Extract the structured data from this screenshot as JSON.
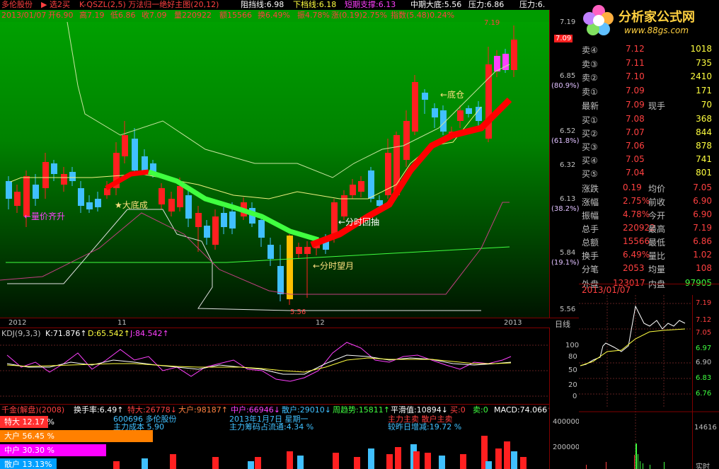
{
  "top": {
    "stock_name": "多伦股份",
    "arrow_select": "▶ 选2买",
    "indicator": "K-QSZL(2,5) 万法归一绝好主图(20,12)",
    "resistance": "阻挡线:6.98",
    "down_line": "下档线:6.18",
    "short_support": "短期支撑:6.13",
    "mid_bottom": "中期大底:5.56",
    "pressure1": "压力:6.86",
    "pressure2": "压力:6.",
    "line2": "2013/01/07",
    "open": "开6.90",
    "high": "高7.19",
    "low": "低6.86",
    "close": "收7.09",
    "volume": "量220922",
    "amount": "额15566",
    "turnover": "换6.49%",
    "amplitude": "振4.78%",
    "change": "涨(0.19)2.75%",
    "index": "指数(5.48)0.24%"
  },
  "chart_labels": {
    "volume_rise": "←量价齐升",
    "big_bottom": "★大底成",
    "minute_pull": "←分时回抽",
    "minute_moon": "←分时望月",
    "bottom_pos": "←底仓",
    "low_price": "5.56",
    "high_price": "7.19"
  },
  "price_axis": {
    "ticks": [
      "7.19",
      "7.09",
      "6.85",
      "(80.9%)",
      "6.52",
      "(61.8%)",
      "6.32",
      "6.13",
      "(38.2%)",
      "5.84",
      "(19.1%)",
      "5.56"
    ]
  },
  "date_axis": {
    "labels": [
      "2012",
      "11",
      "12",
      "2013"
    ],
    "period": "日线"
  },
  "kdj": {
    "title": "KDJ(9,3,3)",
    "k": "K:71.876↑",
    "d": "D:65.542↑",
    "j": "J:84.542↑",
    "ticks": [
      "100",
      "80",
      "50",
      "20",
      "0"
    ]
  },
  "fund": {
    "title": "千金(解盘)(2008)",
    "turnover": "换手率:6.49↑",
    "super_big": "特大:26778↓",
    "big": "大户:98187↑",
    "mid": "中户:66946↓",
    "retail": "散户:29010↓",
    "week_trend": "周趋势:15811↑",
    "smooth": "平滑值:10894↓",
    "buy": "买:0",
    "sell": "卖:0",
    "macd": "MACD:74.066↑",
    "code_name": "600696 多伦股份",
    "cost": "主力成本 5.90",
    "date_text": "2013年1月7日 星期一",
    "chip": "主力筹码占流通:4.34 %",
    "main_status": "主力主卖  散户主卖",
    "change_day": "较昨日增减:19.72 %",
    "vol_ticks": [
      "400000",
      "200000"
    ],
    "bars": [
      {
        "label": "特大 12.17 %",
        "color": "#ff3030"
      },
      {
        "label": "大户 56.45 %",
        "color": "#ff8000"
      },
      {
        "label": "中户 30.30 %",
        "color": "#ff00ff"
      },
      {
        "label": "散户 13.13%",
        "color": "#00a0ff"
      }
    ]
  },
  "side": {
    "logo_text": "分析家公式网",
    "logo_url": "www.88gs.com",
    "asks": [
      {
        "label": "卖④",
        "price": "7.12",
        "vol": "1018"
      },
      {
        "label": "卖③",
        "price": "7.11",
        "vol": "735"
      },
      {
        "label": "卖②",
        "price": "7.10",
        "vol": "2410"
      },
      {
        "label": "卖①",
        "price": "7.09",
        "vol": "171"
      }
    ],
    "latest": {
      "label": "最新",
      "price": "7.09",
      "k2": "现手",
      "v2": "70"
    },
    "bids": [
      {
        "label": "买①",
        "price": "7.08",
        "vol": "368"
      },
      {
        "label": "买②",
        "price": "7.07",
        "vol": "844"
      },
      {
        "label": "买③",
        "price": "7.06",
        "vol": "878"
      },
      {
        "label": "买④",
        "price": "7.05",
        "vol": "741"
      },
      {
        "label": "买⑤",
        "price": "7.04",
        "vol": "801"
      }
    ],
    "stats": [
      {
        "k1": "涨跌",
        "v1": "0.19",
        "k2": "均价",
        "v2": "7.05"
      },
      {
        "k1": "涨幅",
        "v1": "2.75%",
        "k2": "前收",
        "v2": "6.90"
      },
      {
        "k1": "振幅",
        "v1": "4.78%",
        "k2": "今开",
        "v2": "6.90"
      },
      {
        "k1": "总手",
        "v1": "220922",
        "k2": "最高",
        "v2": "7.19"
      },
      {
        "k1": "总额",
        "v1": "15566",
        "k2": "最低",
        "v2": "6.86"
      },
      {
        "k1": "换手",
        "v1": "6.49%",
        "k2": "量比",
        "v2": "1.02"
      },
      {
        "k1": "分笔",
        "v1": "2053",
        "k2": "均量",
        "v2": "108"
      }
    ],
    "outer": {
      "k1": "外盘",
      "v1": "123017",
      "k2": "内盘",
      "v2": "97905"
    },
    "date": "2013/01/07",
    "intraday_ticks": [
      "7.19",
      "7.12",
      "7.05",
      "6.97",
      "6.90",
      "6.83",
      "6.76"
    ],
    "intraday_vol": "14616",
    "realtime": "实时"
  }
}
